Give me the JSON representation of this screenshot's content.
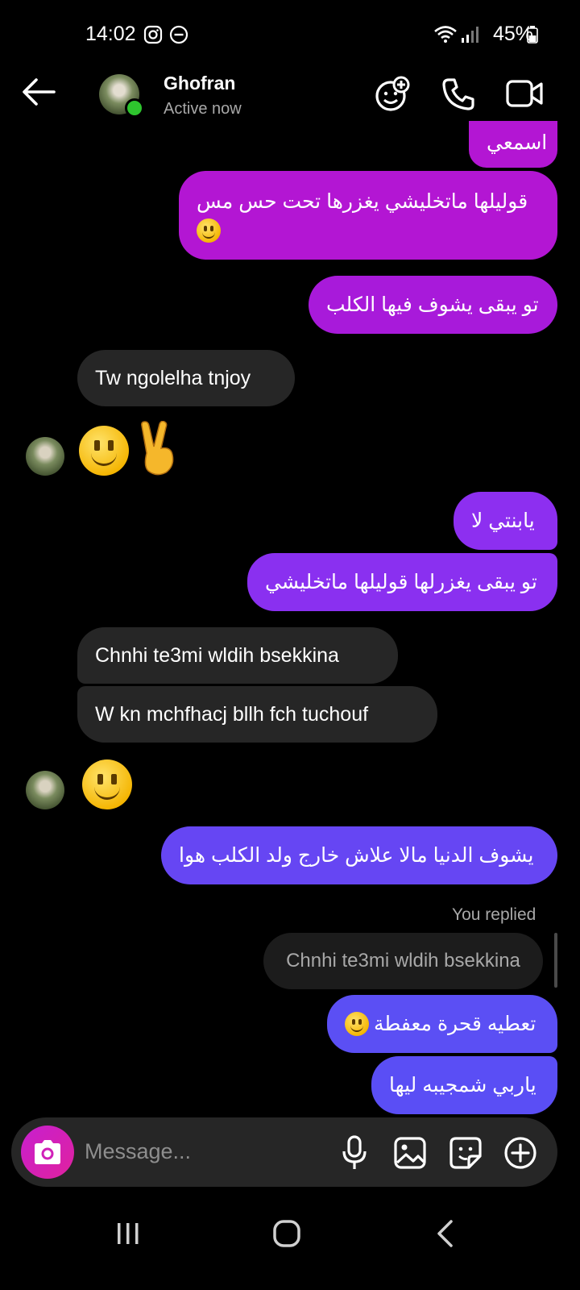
{
  "status_bar": {
    "time": "14:02",
    "battery": "45%"
  },
  "header": {
    "contact_name": "Ghofran",
    "status": "Active now"
  },
  "messages": {
    "m0": "اسمعي",
    "m1_line1": "قوليلها ماتخليشي يغزرها تحت حس مس",
    "m2": "تو يبقى يشوف فيها الكلب",
    "m3": "Tw ngolelha tnjoy",
    "m5": "يابنتي لا",
    "m6": "تو يبقى يغزرلها قوليلها ماتخليشي",
    "m7": "Chnhi te3mi wldih bsekkina",
    "m8": "W kn mchfhacj bllh fch tuchouf",
    "m10": "يشوف الدنيا مالا علاش خارج ولد الكلب هوا",
    "reply_label": "You replied",
    "reply_quote": "Chnhi te3mi wldih bsekkina",
    "m11": "تعطيه قحرة معفطة",
    "m12": "ياربي شمجيبه ليها"
  },
  "input": {
    "placeholder": "Message..."
  },
  "colors": {
    "bubble_magenta": "#b316d3",
    "bubble_purple": "#8c2ff0",
    "bubble_violet": "#7837f2",
    "bubble_indigo": "#5a4ef5",
    "incoming": "#262626",
    "online": "#2ec52e"
  }
}
